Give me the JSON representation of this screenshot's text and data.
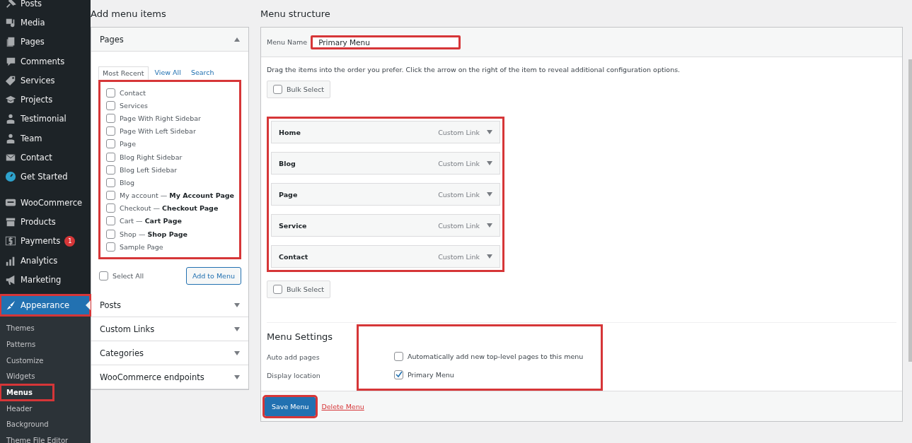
{
  "sidebar": {
    "items": [
      {
        "label": "Posts",
        "selected": false
      },
      {
        "label": "Media",
        "selected": false
      },
      {
        "label": "Pages",
        "selected": false
      },
      {
        "label": "Comments",
        "selected": false
      },
      {
        "label": "Services",
        "selected": false
      },
      {
        "label": "Projects",
        "selected": false
      },
      {
        "label": "Testimonial",
        "selected": false
      },
      {
        "label": "Team",
        "selected": false
      },
      {
        "label": "Contact",
        "selected": false
      },
      {
        "label": "Get Started",
        "selected": false
      },
      {
        "label": "WooCommerce",
        "selected": false
      },
      {
        "label": "Products",
        "selected": false
      },
      {
        "label": "Payments",
        "selected": false,
        "badge": "1"
      },
      {
        "label": "Analytics",
        "selected": false
      },
      {
        "label": "Marketing",
        "selected": false
      },
      {
        "label": "Appearance",
        "selected": true,
        "highlighted": true
      }
    ],
    "submenu": [
      {
        "label": "Themes",
        "selected": false,
        "highlighted": false
      },
      {
        "label": "Patterns",
        "selected": false,
        "highlighted": false
      },
      {
        "label": "Customize",
        "selected": false,
        "highlighted": false
      },
      {
        "label": "Widgets",
        "selected": false,
        "highlighted": false
      },
      {
        "label": "Menus",
        "selected": true,
        "highlighted": true
      },
      {
        "label": "Header",
        "selected": false,
        "highlighted": false
      },
      {
        "label": "Background",
        "selected": false,
        "highlighted": false
      },
      {
        "label": "Theme File Editor",
        "selected": false,
        "highlighted": false
      }
    ]
  },
  "add_menu_items": {
    "title": "Add menu items",
    "pages_panel": {
      "title": "Pages",
      "expanded": true,
      "tabs": [
        {
          "label": "Most Recent",
          "selected": true
        },
        {
          "label": "View All",
          "selected": false
        },
        {
          "label": "Search",
          "selected": false
        }
      ],
      "list_highlighted": true,
      "pages": [
        {
          "title": "Contact",
          "checked": false
        },
        {
          "title": "Services",
          "checked": false
        },
        {
          "title": "Page With Right Sidebar",
          "checked": false
        },
        {
          "title": "Page With Left Sidebar",
          "checked": false
        },
        {
          "title": "Page",
          "checked": false
        },
        {
          "title": "Blog Right Sidebar",
          "checked": false
        },
        {
          "title": "Blog Left Sidebar",
          "checked": false
        },
        {
          "title": "Blog",
          "checked": false
        },
        {
          "title": "My account — **My Account Page**",
          "checked": false
        },
        {
          "title": "Checkout — **Checkout Page**",
          "checked": false
        },
        {
          "title": "Cart — **Cart Page**",
          "checked": false
        },
        {
          "title": "Shop — **Shop Page**",
          "checked": false
        },
        {
          "title": "Sample Page",
          "checked": false
        }
      ],
      "select_all": {
        "label": "Select All",
        "checked": false
      },
      "add_button": "Add to Menu"
    },
    "other_panels": [
      {
        "title": "Posts",
        "expanded": false
      },
      {
        "title": "Custom Links",
        "expanded": false
      },
      {
        "title": "Categories",
        "expanded": false
      },
      {
        "title": "WooCommerce endpoints",
        "expanded": false
      }
    ]
  },
  "menu_structure": {
    "title": "Menu structure",
    "menu_name": {
      "label": "Menu Name",
      "value": "Primary Menu",
      "highlighted": true
    },
    "instructions": "Drag the items into the order you prefer. Click the arrow on the right of the item to reveal additional configuration options.",
    "bulk_select_top": {
      "label": "Bulk Select",
      "checked": false
    },
    "items_highlighted": true,
    "items": [
      {
        "title": "Home",
        "type": "Custom Link"
      },
      {
        "title": "Blog",
        "type": "Custom Link"
      },
      {
        "title": "Page",
        "type": "Custom Link"
      },
      {
        "title": "Service",
        "type": "Custom Link"
      },
      {
        "title": "Contact",
        "type": "Custom Link"
      }
    ],
    "bulk_select_bottom": {
      "label": "Bulk Select",
      "checked": false
    },
    "settings": {
      "title": "Menu Settings",
      "highlighted": true,
      "rows": [
        {
          "label": "Auto add pages",
          "option": "Automatically add new top-level pages to this menu",
          "checked": false
        },
        {
          "label": "Display location",
          "option": "Primary Menu",
          "checked": true
        }
      ]
    },
    "save_button": {
      "label": "Save Menu",
      "highlighted": true
    },
    "delete_link": "Delete Menu"
  }
}
